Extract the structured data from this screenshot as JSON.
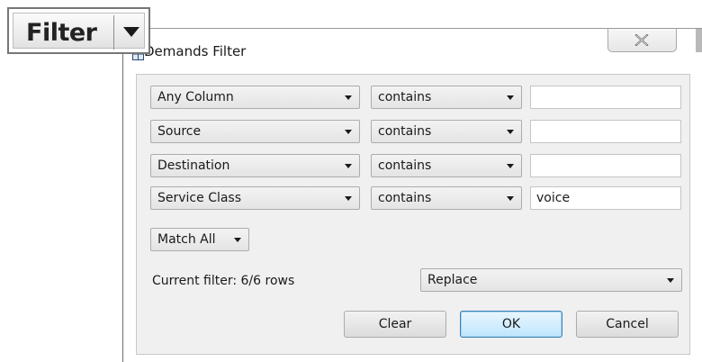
{
  "dialog": {
    "title": "Demands  Filter",
    "rows": [
      {
        "column": "Any Column",
        "operator": "contains",
        "value": ""
      },
      {
        "column": "Source",
        "operator": "contains",
        "value": ""
      },
      {
        "column": "Destination",
        "operator": "contains",
        "value": ""
      },
      {
        "column": "Service Class",
        "operator": "contains",
        "value": "voice"
      }
    ],
    "match_mode": "Match All",
    "status": "Current filter: 6/6 rows",
    "replace_mode": "Replace",
    "buttons": {
      "clear": "Clear",
      "ok": "OK",
      "cancel": "Cancel"
    }
  },
  "filter_button": {
    "label": "Filter"
  },
  "icons": {
    "close": "close-icon",
    "dropdown": "chevron-down-icon",
    "app": "table-icon"
  },
  "colors": {
    "ok_border": "#3c7fb1",
    "ok_fill": "#bee6fd",
    "content_bg": "#f0f0f0"
  }
}
